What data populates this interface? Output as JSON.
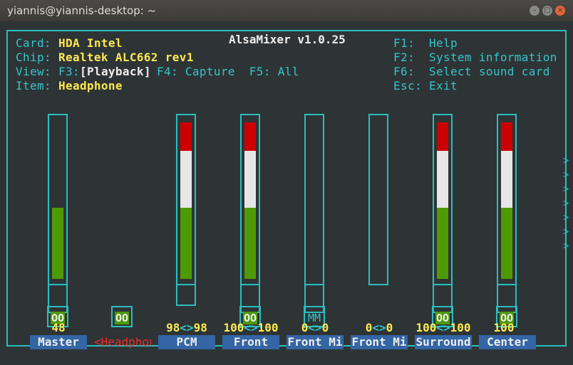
{
  "window": {
    "title": "yiannis@yiannis-desktop: ~",
    "buttons": [
      "–",
      "□",
      "×"
    ]
  },
  "app": {
    "title": "AlsaMixer v1.0.25"
  },
  "info": {
    "card_label": "Card:",
    "card": "HDA Intel",
    "chip_label": "Chip:",
    "chip": "Realtek ALC662 rev1",
    "view_label": "View:",
    "view_f3": "F3:",
    "view_playback": "[Playback]",
    "view_rest": " F4: Capture  F5: All",
    "item_label": "Item:",
    "item": "Headphone"
  },
  "keys": [
    {
      "key": "F1:",
      "desc": "Help"
    },
    {
      "key": "F2:",
      "desc": "System information"
    },
    {
      "key": "F6:",
      "desc": "Select sound card"
    },
    {
      "key": "Esc:",
      "desc": "Exit"
    }
  ],
  "channels": [
    {
      "name": "Master",
      "value": "48",
      "level": 0.48,
      "switch": "OO"
    },
    {
      "name": "<Headphon>",
      "value": "",
      "level": null,
      "switch": "OO",
      "selected": true
    },
    {
      "name": "PCM",
      "value_l": "98",
      "value_r": "98",
      "level": 0.98,
      "switch": null
    },
    {
      "name": "Front",
      "value_l": "100",
      "value_r": "100",
      "level": 1.0,
      "switch": "OO"
    },
    {
      "name": "Front Mi",
      "value_l": "0",
      "value_r": "0",
      "level": 0,
      "switch": "MM"
    },
    {
      "name": "Front Mi",
      "value_l": "0",
      "value_r": "0",
      "level": 0,
      "switch": null
    },
    {
      "name": "Surround",
      "value_l": "100",
      "value_r": "100",
      "level": 1.0,
      "switch": "OO"
    },
    {
      "name": "Center",
      "value": "100",
      "level": 1.0,
      "switch": "OO"
    }
  ],
  "more_indicator": ">"
}
